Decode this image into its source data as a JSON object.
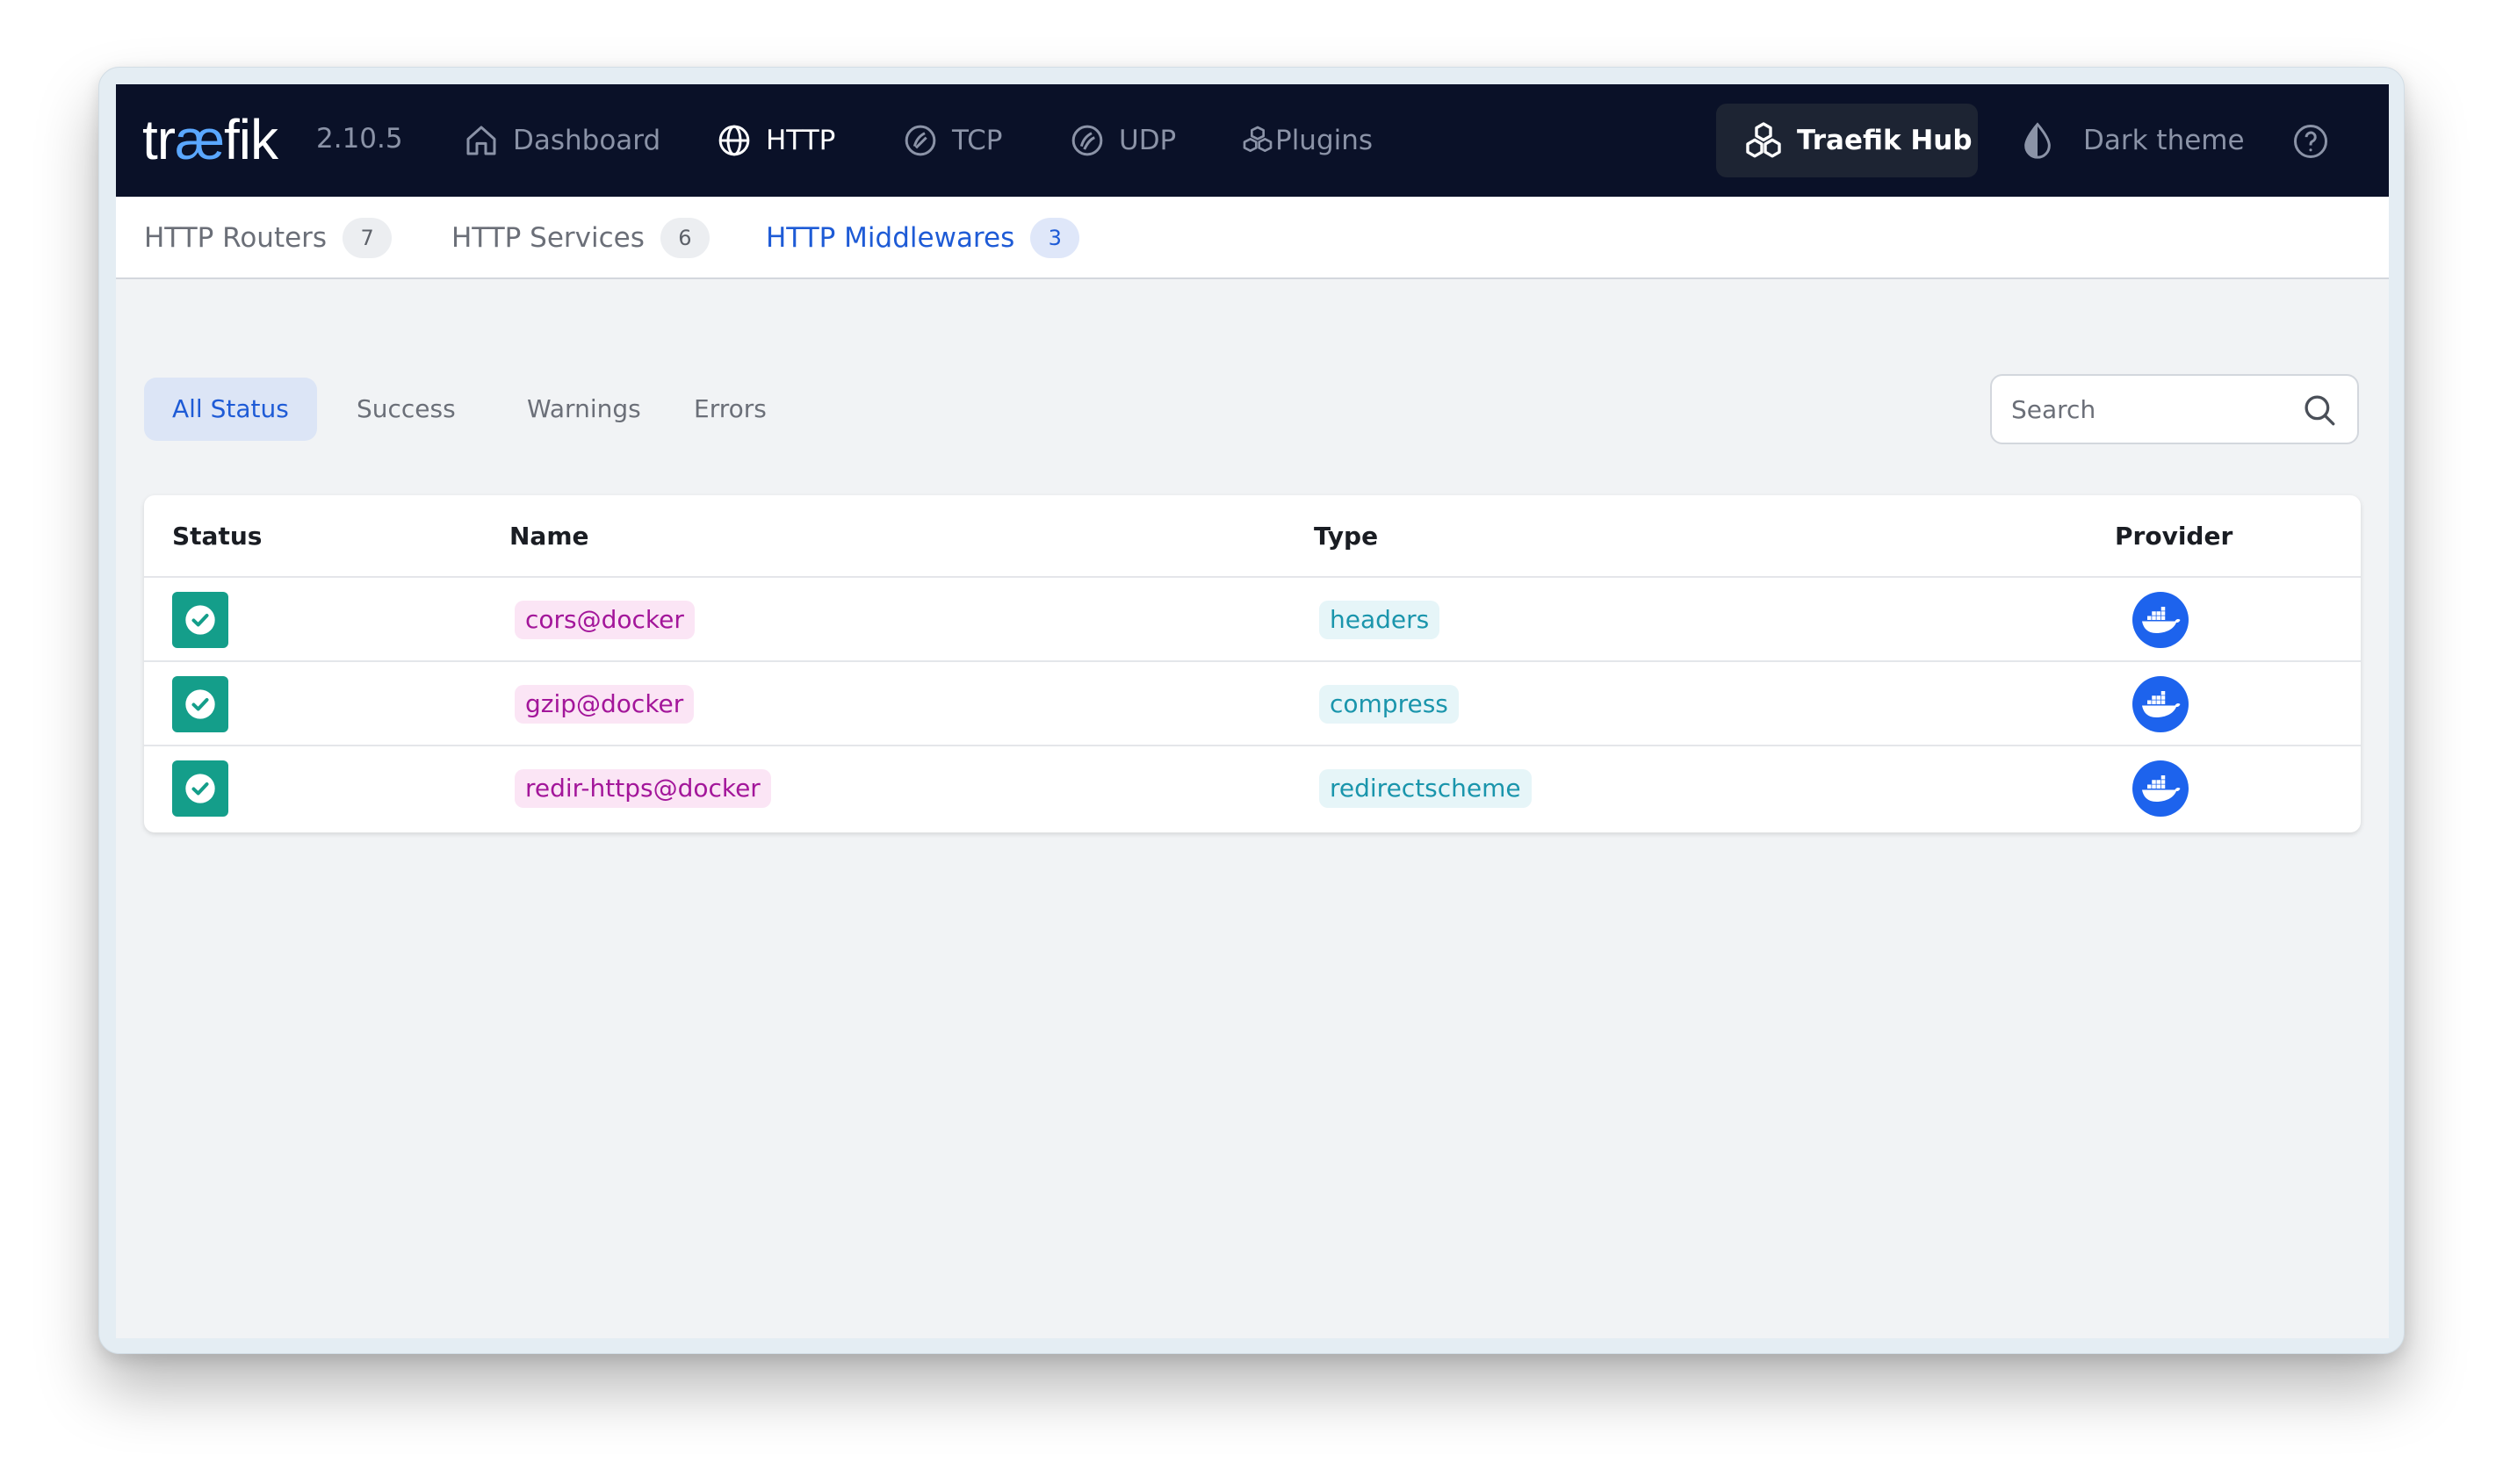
{
  "app": {
    "logo_text_1": "tr",
    "logo_text_2": "æ",
    "logo_text_3": "fik",
    "version": "2.10.5"
  },
  "nav": {
    "items": [
      {
        "label": "Dashboard",
        "icon": "home-icon"
      },
      {
        "label": "HTTP",
        "icon": "globe-icon",
        "active": true
      },
      {
        "label": "TCP",
        "icon": "tcp-icon"
      },
      {
        "label": "UDP",
        "icon": "udp-icon"
      },
      {
        "label": "Plugins",
        "icon": "plugins-icon"
      }
    ],
    "hub_label": "Traefik Hub",
    "dark_theme_label": "Dark theme",
    "help_icon": "help-icon"
  },
  "subtabs": [
    {
      "label": "HTTP Routers",
      "count": "7"
    },
    {
      "label": "HTTP Services",
      "count": "6"
    },
    {
      "label": "HTTP Middlewares",
      "count": "3",
      "active": true
    }
  ],
  "filters": [
    "All Status",
    "Success",
    "Warnings",
    "Errors"
  ],
  "search": {
    "placeholder": "Search"
  },
  "table": {
    "headers": {
      "status": "Status",
      "name": "Name",
      "type": "Type",
      "provider": "Provider"
    },
    "rows": [
      {
        "status": "success",
        "name": "cors@docker",
        "type": "headers",
        "provider": "docker"
      },
      {
        "status": "success",
        "name": "gzip@docker",
        "type": "compress",
        "provider": "docker"
      },
      {
        "status": "success",
        "name": "redir-https@docker",
        "type": "redirectscheme",
        "provider": "docker"
      }
    ]
  },
  "colors": {
    "nav_bg": "#0a1128",
    "accent": "#1e5bd6",
    "success": "#149e8a",
    "name_chip_text": "#a3169a",
    "type_chip_text": "#1a95ac",
    "docker_blue": "#1d63ed"
  }
}
